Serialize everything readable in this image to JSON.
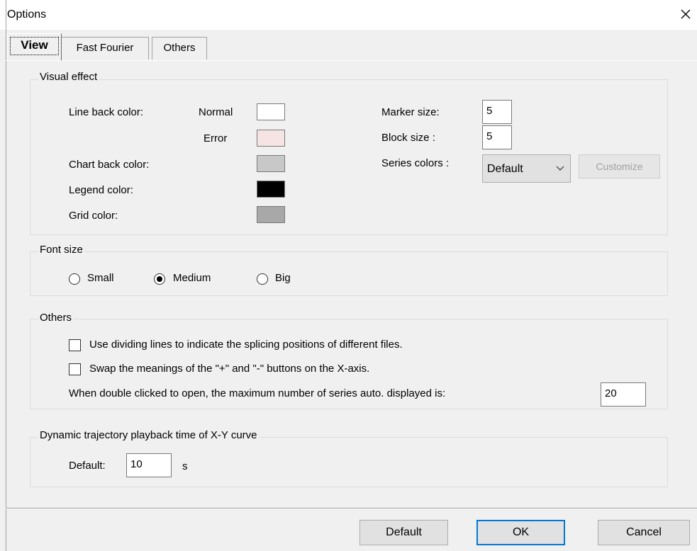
{
  "window": {
    "title": "Options"
  },
  "tabs": [
    {
      "label": "View",
      "active": true
    },
    {
      "label": "Fast Fourier",
      "active": false
    },
    {
      "label": "Others",
      "active": false
    }
  ],
  "visual_effect": {
    "title": "Visual effect",
    "line_back_color_label": "Line back color:",
    "normal_label": "Normal",
    "error_label": "Error",
    "chart_back_color_label": "Chart back color:",
    "legend_color_label": "Legend color:",
    "grid_color_label": "Grid color:",
    "colors": {
      "normal": "#ffffff",
      "error": "#f6e4e4",
      "chart_back": "#c8c8c8",
      "legend": "#000000",
      "grid": "#a8a8a8"
    },
    "marker_size_label": "Marker size:",
    "marker_size_value": "5",
    "block_size_label": "Block size :",
    "block_size_value": "5",
    "series_colors_label": "Series colors :",
    "series_colors_selected": "Default",
    "customize_label": "Customize"
  },
  "font_size": {
    "title": "Font size",
    "options": [
      {
        "label": "Small",
        "checked": false
      },
      {
        "label": "Medium",
        "checked": true
      },
      {
        "label": "Big",
        "checked": false
      }
    ]
  },
  "others": {
    "title": "Others",
    "checkbox_dividing": "Use dividing lines to indicate the splicing positions of different files.",
    "checkbox_swap": "Swap the meanings of the \"+\" and \"-\" buttons on the X-axis.",
    "max_series_label": "When double clicked to open, the maximum number of series auto. displayed is:",
    "max_series_value": "20"
  },
  "playback": {
    "title": "Dynamic trajectory playback time of X-Y curve",
    "default_label": "Default:",
    "default_value": "10",
    "unit": "s"
  },
  "buttons": {
    "default": "Default",
    "ok": "OK",
    "cancel": "Cancel"
  },
  "accent_color": "#0078d7"
}
